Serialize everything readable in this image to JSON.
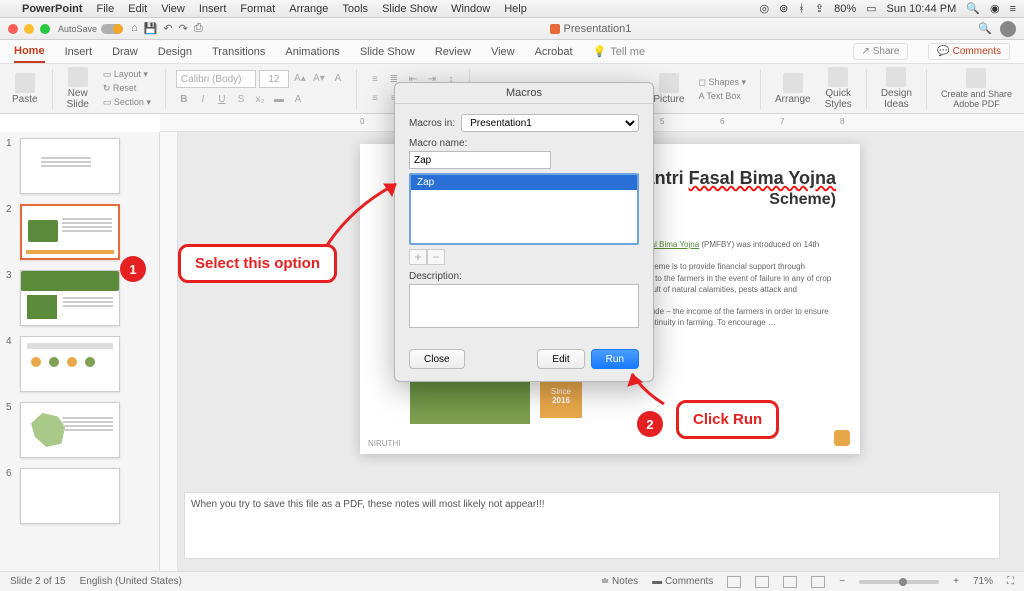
{
  "macMenu": {
    "app": "PowerPoint",
    "items": [
      "File",
      "Edit",
      "View",
      "Insert",
      "Format",
      "Arrange",
      "Tools",
      "Slide Show",
      "Window",
      "Help"
    ],
    "battery": "80%",
    "clock": "Sun 10:44 PM"
  },
  "titlebar": {
    "autosave": "AutoSave",
    "docTitle": "Presentation1"
  },
  "ribbonTabs": [
    "Home",
    "Insert",
    "Draw",
    "Design",
    "Transitions",
    "Animations",
    "Slide Show",
    "Review",
    "View",
    "Acrobat"
  ],
  "ribbonTellMe": "Tell me",
  "shareLabel": "Share",
  "commentsLabel": "Comments",
  "ribbon": {
    "paste": "Paste",
    "newSlide": "New\nSlide",
    "layout": "Layout",
    "reset": "Reset",
    "section": "Section",
    "fontName": "Calibri (Body)",
    "fontSize": "12",
    "picture": "Picture",
    "textBox": "Text Box",
    "shapes": "Shapes",
    "arrange": "Arrange",
    "quickStyles": "Quick\nStyles",
    "designIdeas": "Design\nIdeas",
    "adobe": "Create and Share\nAdobe PDF"
  },
  "dialog": {
    "title": "Macros",
    "macrosInLabel": "Macros in:",
    "macrosInValue": "Presentation1",
    "macroNameLabel": "Macro name:",
    "macroNameValue": "Zap",
    "listItem": "Zap",
    "descriptionLabel": "Description:",
    "closeBtn": "Close",
    "editBtn": "Edit",
    "runBtn": "Run"
  },
  "slide": {
    "title1a": "Mantri ",
    "title1b": "Fasal Bima Yojna",
    "title2": "Scheme)",
    "para1a": "ntri ",
    "para1b": "Fasal Bima Yojna",
    "para1c": " (PMFBY) was introduced on 14th",
    "para2": "f the scheme is to provide financial support through overage to the farmers in the event of failure in any of crop as a result of natural calamities, pests attack and",
    "para3": "ves include – the income of the farmers in order to ensure their continuity in farming. To encourage …",
    "sinceLabel": "Since",
    "sinceYear": "2016",
    "logo": "NIRUTHI"
  },
  "notesText": "When you try to save this file as a PDF, these notes will most likely not appear!!!",
  "annotations": {
    "badge1": "1",
    "callout1": "Select this option",
    "badge2": "2",
    "callout2": "Click Run"
  },
  "status": {
    "slideInfo": "Slide 2 of 15",
    "language": "English (United States)",
    "notes": "Notes",
    "comments": "Comments",
    "zoom": "71%"
  }
}
